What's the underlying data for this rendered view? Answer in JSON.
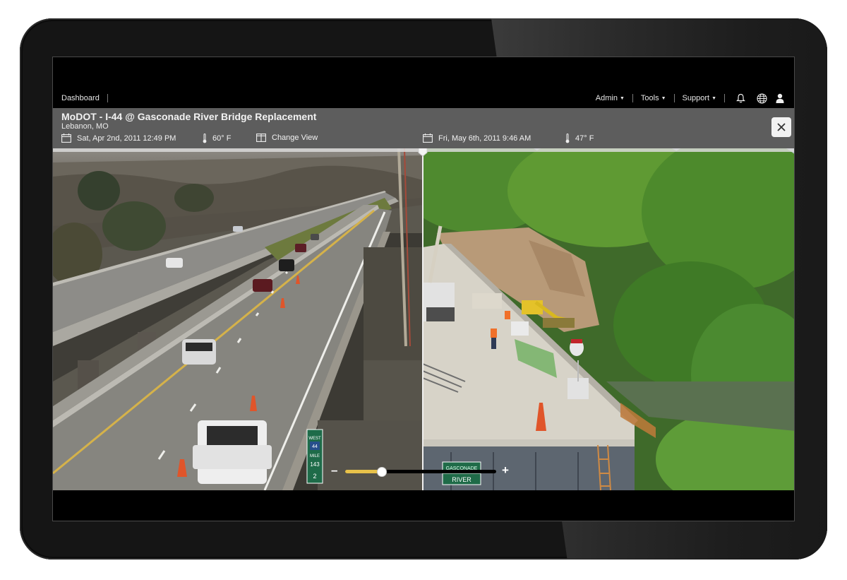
{
  "nav": {
    "dashboard": "Dashboard",
    "admin": "Admin",
    "tools": "Tools",
    "support": "Support"
  },
  "project": {
    "title": "MoDOT - I-44 @ Gasconade River Bridge Replacement",
    "location": "Lebanon, MO"
  },
  "left_view": {
    "datetime": "Sat, Apr 2nd, 2011 12:49 PM",
    "temperature": "60° F",
    "change_view": "Change View"
  },
  "right_view": {
    "datetime": "Fri, May 6th, 2011 9:46 AM",
    "temperature": "47° F"
  },
  "signs": {
    "left_route": [
      "WEST",
      "44",
      "MILE",
      "143",
      "2"
    ],
    "right_sign": [
      "GASCONADE",
      "RIVER"
    ]
  },
  "zoom": {
    "level": 0.22
  },
  "colors": {
    "accent": "#e8c24a",
    "infobar": "#5d5d5d"
  },
  "icons": [
    "calendar-icon",
    "thermometer-icon",
    "change-view-icon",
    "bell-icon",
    "globe-icon",
    "user-icon",
    "close-icon"
  ]
}
